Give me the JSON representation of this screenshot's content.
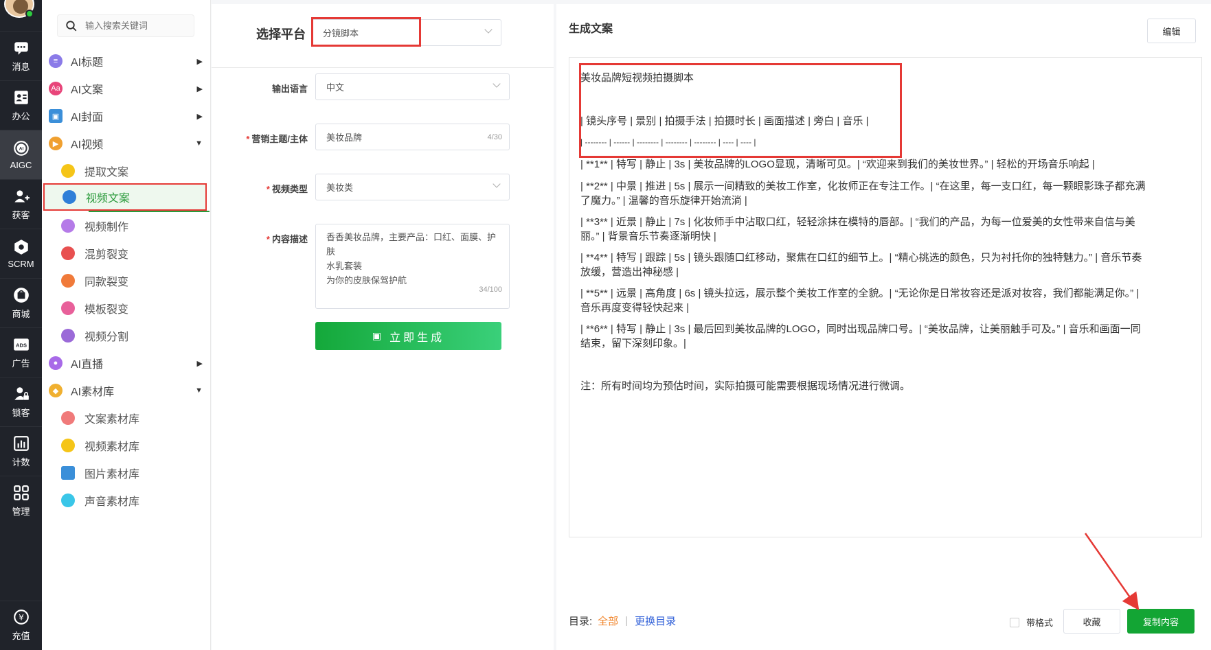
{
  "rail": {
    "items": [
      {
        "label": "消息",
        "icon": "chat-icon"
      },
      {
        "label": "办公",
        "icon": "contact-card-icon"
      },
      {
        "label": "AIGC",
        "icon": "ai-chip-icon"
      },
      {
        "label": "获客",
        "icon": "user-add-icon"
      },
      {
        "label": "SCRM",
        "icon": "hexagon-icon"
      },
      {
        "label": "商城",
        "icon": "store-icon"
      },
      {
        "label": "广告",
        "icon": "ads-icon"
      },
      {
        "label": "锁客",
        "icon": "user-lock-icon"
      },
      {
        "label": "计数",
        "icon": "bar-chart-icon"
      },
      {
        "label": "管理",
        "icon": "grid-icon"
      },
      {
        "label": "充值",
        "icon": "yen-icon"
      }
    ]
  },
  "search": {
    "placeholder": "输入搜索关键词"
  },
  "menu": {
    "ai_title": "AI标题",
    "ai_copy": "AI文案",
    "ai_cover": "AI封面",
    "ai_video": "AI视频",
    "extract_copy": "提取文案",
    "video_copy": "视频文案",
    "video_make": "视频制作",
    "mix_split": "混剪裂变",
    "same_split": "同款裂变",
    "template_split": "模板裂变",
    "video_split": "视频分割",
    "ai_live": "AI直播",
    "ai_assets": "AI素材库",
    "copy_assets": "文案素材库",
    "video_assets": "视频素材库",
    "image_assets": "图片素材库",
    "audio_assets": "声音素材库"
  },
  "form": {
    "platform_label": "选择平台",
    "platform_value": "分镜脚本",
    "lang_label": "输出语言",
    "lang_value": "中文",
    "topic_label": "营销主题/主体",
    "topic_value": "美妆品牌",
    "topic_count": "4/30",
    "type_label": "视频类型",
    "type_value": "美妆类",
    "desc_label": "内容描述",
    "desc_line1": "香香美妆品牌，主要产品：口红、面膜、护肤",
    "desc_line2": "水乳套装",
    "desc_line3": "为你的皮肤保驾护航",
    "desc_count": "34/100",
    "generate": "立即生成"
  },
  "result": {
    "title": "生成文案",
    "edit": "编辑",
    "lines": [
      "美妆品牌短视频拍摄脚本",
      "| 镜头序号 | 景别 | 拍摄手法 | 拍摄时长 | 画面描述 | 旁白 | 音乐 |",
      "| -------- | ------ | -------- | -------- | -------- | ---- | ---- |",
      "| **1** | 特写 | 静止 | 3s | 美妆品牌的LOGO显现，清晰可见。| “欢迎来到我们的美妆世界。” | 轻松的开场音乐响起 |",
      "| **2** | 中景 | 推进 | 5s | 展示一间精致的美妆工作室，化妆师正在专注工作。| “在这里，每一支口红，每一颗眼影珠子都充满",
      "了魔力。” | 温馨的音乐旋律开始流淌 |",
      "| **3** | 近景 | 静止 | 7s | 化妆师手中沾取口红，轻轻涂抹在模特的唇部。| “我们的产品，为每一位爱美的女性带来自信与美",
      "丽。” | 背景音乐节奏逐渐明快 |",
      "| **4** | 特写 | 跟踪 | 5s | 镜头跟随口红移动，聚焦在口红的细节上。| “精心挑选的颜色，只为衬托你的独特魅力。” | 音乐节奏",
      "放缓，营造出神秘感 |",
      "| **5** | 远景 | 高角度 | 6s | 镜头拉远，展示整个美妆工作室的全貌。| “无论你是日常妆容还是派对妆容，我们都能满足你。” |",
      "音乐再度变得轻快起来 |",
      "| **6** | 特写 | 静止 | 3s | 最后回到美妆品牌的LOGO，同时出现品牌口号。| “美妆品牌，让美丽触手可及。” | 音乐和画面一同",
      "结束，留下深刻印象。|",
      "注：所有时间均为预估时间，实际拍摄可能需要根据现场情况进行微调。"
    ],
    "toc_label": "目录:",
    "toc_all": "全部",
    "toc_change": "更换目录",
    "with_format": "带格式",
    "favorite": "收藏",
    "copy": "复制内容"
  },
  "colors": {
    "accent": "#13a534",
    "highlight": "#e53935",
    "rail_bg": "#20232a"
  }
}
